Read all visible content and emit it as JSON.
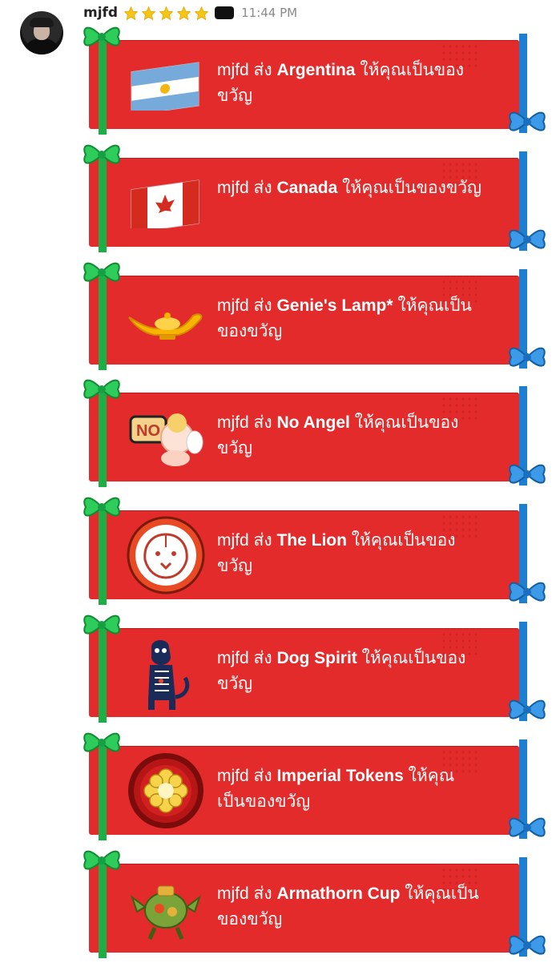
{
  "message": {
    "username": "mjfd",
    "time": "11:44 PM",
    "stars": 5
  },
  "gifts": [
    {
      "sender": "mjfd",
      "verb": "ส่ง",
      "item": "Argentina",
      "suffix": "ให้คุณเป็นของขวัญ",
      "icon": "argentina-flag-icon"
    },
    {
      "sender": "mjfd",
      "verb": "ส่ง",
      "item": "Canada",
      "suffix": "ให้คุณเป็นของขวัญ",
      "icon": "canada-flag-icon"
    },
    {
      "sender": "mjfd",
      "verb": "ส่ง",
      "item": "Genie's Lamp*",
      "suffix": "ให้คุณเป็นของขวัญ",
      "icon": "genie-lamp-icon"
    },
    {
      "sender": "mjfd",
      "verb": "ส่ง",
      "item": "No Angel",
      "suffix": "ให้คุณเป็นของขวัญ",
      "icon": "no-angel-sticker-icon"
    },
    {
      "sender": "mjfd",
      "verb": "ส่ง",
      "item": "The Lion",
      "suffix": "ให้คุณเป็นของขวัญ",
      "icon": "lion-emblem-icon"
    },
    {
      "sender": "mjfd",
      "verb": "ส่ง",
      "item": "Dog Spirit",
      "suffix": "ให้คุณเป็นของขวัญ",
      "icon": "dog-skeleton-icon"
    },
    {
      "sender": "mjfd",
      "verb": "ส่ง",
      "item": "Imperial Tokens",
      "suffix": "ให้คุณเป็นของขวัญ",
      "icon": "imperial-token-icon"
    },
    {
      "sender": "mjfd",
      "verb": "ส่ง",
      "item": "Armathorn Cup",
      "suffix": "ให้คุณเป็นของขวัญ",
      "icon": "armathorn-cup-icon"
    }
  ],
  "colors": {
    "card": "#e32b2b",
    "ribbon_green": "#1eae46",
    "ribbon_blue": "#1e7fd0",
    "star": "#f5c518"
  }
}
